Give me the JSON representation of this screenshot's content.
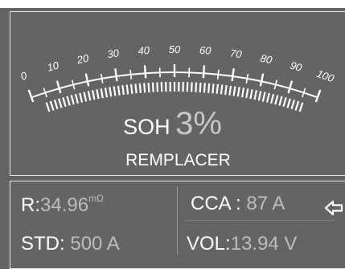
{
  "gauge": {
    "scale_labels": [
      "0",
      "10",
      "20",
      "30",
      "40",
      "50",
      "60",
      "70",
      "80",
      "90",
      "100"
    ],
    "soh_label": "SOH",
    "soh_value": "3%",
    "soh_percent": 3,
    "status": "REMPLACER"
  },
  "readings": {
    "r_label": "R:",
    "r_value": "34.96",
    "r_unit": "mΩ",
    "cca_label": "CCA :",
    "cca_value": "87 A",
    "std_label": "STD:",
    "std_value": "500 A",
    "vol_label": "VOL:",
    "vol_value": "13.94 V"
  },
  "colors": {
    "background": "#646464",
    "frame": "#e6e6e6",
    "text": "#ffffff",
    "value_text": "#bdbdbd"
  },
  "icons": {
    "next": "arrow-left-icon"
  }
}
